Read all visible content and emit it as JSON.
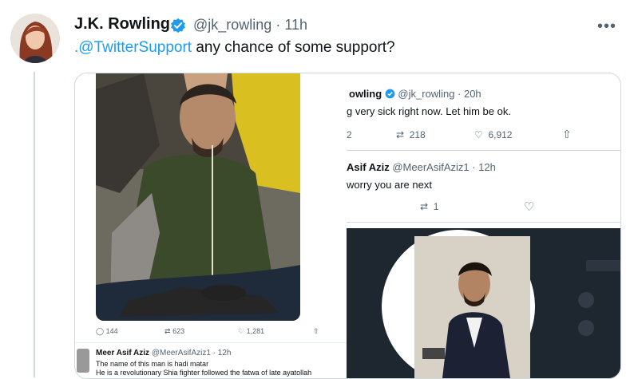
{
  "tweet": {
    "author_name": "J.K. Rowling",
    "handle": "@jk_rowling",
    "separator": "·",
    "time": "11h",
    "more_label": "•••",
    "mention": ".@TwitterSupport",
    "text": " any chance of some support?"
  },
  "media": {
    "left_tweet": {
      "stats": {
        "replies": "144",
        "retweets": "623",
        "likes": "1,281"
      },
      "reply_name": "Meer Asif Aziz",
      "reply_handle": "@MeerAsifAziz1 · 12h",
      "reply_line1": "The name of this man is hadi matar",
      "reply_line2": "He is a revolutionary Shia fighter followed the fatwa of late ayatollah"
    },
    "right_tweet": {
      "name_partial": "owling",
      "handle": "@jk_rowling · 20h",
      "text_partial": "g very sick right now. Let him be ok.",
      "stats": {
        "replies_partial": "2",
        "retweets": "218",
        "likes": "6,912"
      },
      "reply_name_partial": "Asif Aziz",
      "reply_handle": "@MeerAsifAziz1 · 12h",
      "reply_text_partial": "worry you are next",
      "reply_retweets": "1"
    }
  },
  "colors": {
    "accent": "#1d9bf0",
    "muted": "#536471",
    "border": "#cfd9de"
  }
}
